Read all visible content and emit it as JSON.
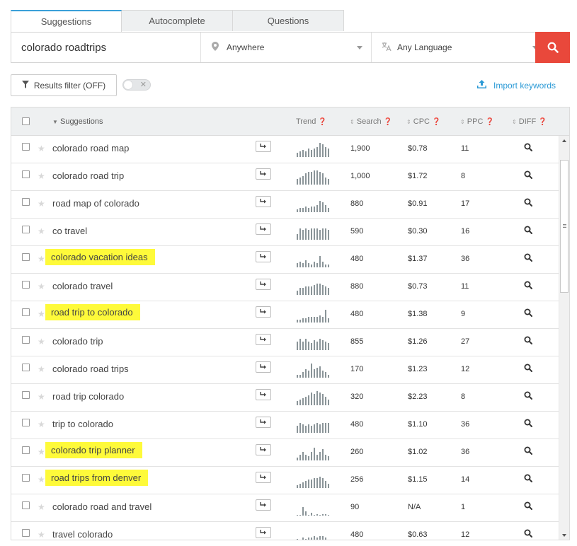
{
  "tabs": [
    {
      "label": "Suggestions",
      "active": true
    },
    {
      "label": "Autocomplete",
      "active": false
    },
    {
      "label": "Questions",
      "active": false
    }
  ],
  "search": {
    "query": "colorado roadtrips",
    "location": "Anywhere",
    "language": "Any Language",
    "button_color": "#e9483b"
  },
  "filter": {
    "label": "Results filter (OFF)",
    "toggle_on": false
  },
  "import": {
    "label": "Import keywords",
    "color": "#2b9ad6"
  },
  "table": {
    "headers": {
      "suggestions": "Suggestions",
      "trend": "Trend",
      "search": "Search",
      "cpc": "CPC",
      "ppc": "PPC",
      "diff": "DIFF"
    },
    "highlight_color": "#fefa3a",
    "rows": [
      {
        "keyword": "colorado road map",
        "search": "1,900",
        "cpc": "$0.78",
        "ppc": "11",
        "highlight": false,
        "trend": [
          3,
          4,
          5,
          4,
          6,
          5,
          6,
          7,
          10,
          9,
          7,
          6
        ]
      },
      {
        "keyword": "colorado road trip",
        "search": "1,000",
        "cpc": "$1.72",
        "ppc": "8",
        "highlight": false,
        "trend": [
          4,
          5,
          6,
          8,
          9,
          9,
          10,
          10,
          9,
          8,
          5,
          4
        ]
      },
      {
        "keyword": "road map of colorado",
        "search": "880",
        "cpc": "$0.91",
        "ppc": "17",
        "highlight": false,
        "trend": [
          2,
          3,
          3,
          4,
          3,
          4,
          4,
          5,
          8,
          7,
          5,
          3
        ]
      },
      {
        "keyword": "co travel",
        "search": "590",
        "cpc": "$0.30",
        "ppc": "16",
        "highlight": false,
        "trend": [
          4,
          8,
          7,
          8,
          7,
          8,
          8,
          8,
          7,
          8,
          8,
          7
        ]
      },
      {
        "keyword": "colorado vacation ideas",
        "search": "480",
        "cpc": "$1.37",
        "ppc": "36",
        "highlight": true,
        "trend": [
          3,
          4,
          3,
          5,
          3,
          2,
          4,
          3,
          8,
          4,
          2,
          2
        ]
      },
      {
        "keyword": "colorado travel",
        "search": "880",
        "cpc": "$0.73",
        "ppc": "11",
        "highlight": false,
        "trend": [
          3,
          5,
          5,
          6,
          6,
          6,
          7,
          8,
          8,
          7,
          6,
          5
        ]
      },
      {
        "keyword": "road trip to colorado",
        "search": "480",
        "cpc": "$1.38",
        "ppc": "9",
        "highlight": true,
        "trend": [
          2,
          2,
          3,
          3,
          4,
          4,
          4,
          4,
          5,
          4,
          9,
          3
        ]
      },
      {
        "keyword": "colorado trip",
        "search": "855",
        "cpc": "$1.26",
        "ppc": "27",
        "highlight": false,
        "trend": [
          6,
          8,
          6,
          8,
          6,
          5,
          7,
          6,
          8,
          7,
          6,
          5
        ]
      },
      {
        "keyword": "colorado road trips",
        "search": "170",
        "cpc": "$1.23",
        "ppc": "12",
        "highlight": false,
        "trend": [
          2,
          2,
          4,
          6,
          5,
          10,
          6,
          7,
          8,
          5,
          4,
          2
        ]
      },
      {
        "keyword": "road trip colorado",
        "search": "320",
        "cpc": "$2.23",
        "ppc": "8",
        "highlight": false,
        "trend": [
          3,
          4,
          5,
          6,
          7,
          9,
          8,
          10,
          9,
          8,
          6,
          4
        ]
      },
      {
        "keyword": "trip to colorado",
        "search": "480",
        "cpc": "$1.10",
        "ppc": "36",
        "highlight": false,
        "trend": [
          5,
          7,
          6,
          5,
          6,
          5,
          6,
          7,
          6,
          7,
          7,
          7
        ]
      },
      {
        "keyword": "colorado trip planner",
        "search": "260",
        "cpc": "$1.02",
        "ppc": "36",
        "highlight": true,
        "trend": [
          2,
          4,
          6,
          4,
          3,
          6,
          9,
          4,
          6,
          8,
          4,
          3
        ]
      },
      {
        "keyword": "road trips from denver",
        "search": "256",
        "cpc": "$1.15",
        "ppc": "14",
        "highlight": true,
        "trend": [
          2,
          3,
          4,
          5,
          6,
          6,
          7,
          7,
          8,
          7,
          5,
          3
        ]
      },
      {
        "keyword": "colorado road and travel",
        "search": "90",
        "cpc": "N/A",
        "ppc": "1",
        "highlight": false,
        "trend": [
          0,
          0,
          6,
          3,
          0,
          2,
          0,
          1,
          0,
          1,
          1,
          0
        ]
      },
      {
        "keyword": "travel colorado",
        "search": "480",
        "cpc": "$0.63",
        "ppc": "12",
        "highlight": false,
        "trend": [
          3,
          2,
          4,
          3,
          4,
          4,
          5,
          4,
          5,
          5,
          4,
          2
        ]
      }
    ]
  }
}
